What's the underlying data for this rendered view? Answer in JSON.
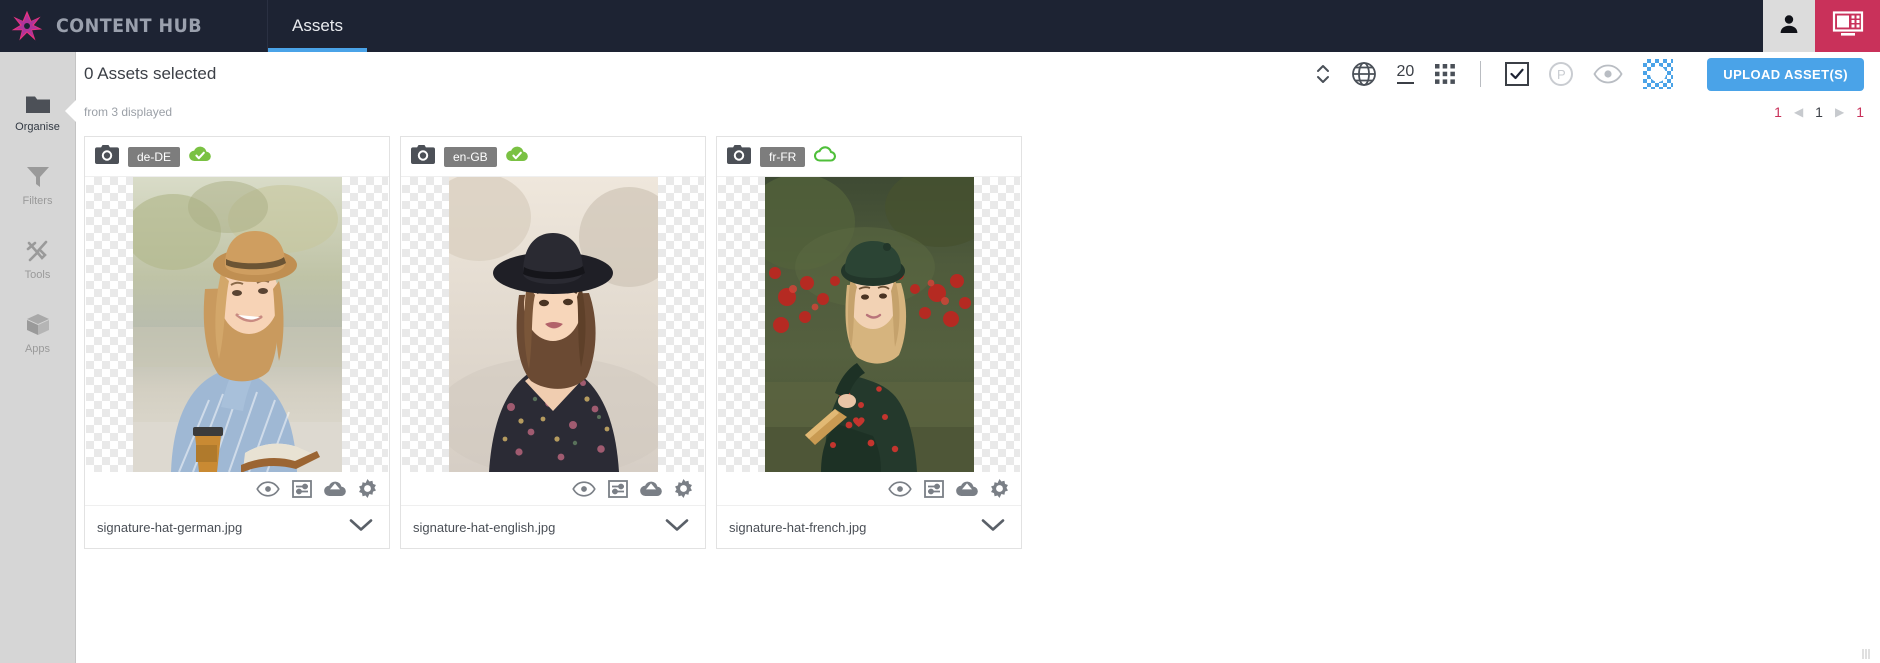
{
  "header": {
    "brand_name": "CONTENT HUB",
    "logo_icon": "starburst-logo-icon",
    "tabs": [
      {
        "label": "Assets",
        "active": true
      }
    ],
    "user_icon": "user-avatar-icon",
    "dashboard_icon": "dashboard-grid-icon",
    "user_bg": "#dcdcdc",
    "dashboard_bg": "#c9315a",
    "bar_bg": "#1d2333",
    "tab_underline": "#4aa3e8"
  },
  "sidebar": {
    "items": [
      {
        "label": "Organise",
        "icon": "folder-icon",
        "active": true
      },
      {
        "label": "Filters",
        "icon": "funnel-icon",
        "active": false
      },
      {
        "label": "Tools",
        "icon": "wrench-hammer-icon",
        "active": false
      },
      {
        "label": "Apps",
        "icon": "cube-box-icon",
        "active": false
      }
    ]
  },
  "toolbar": {
    "selected_text": "0 Assets selected",
    "sort_icon": "sort-updown-icon",
    "globe_icon": "globe-icon",
    "page_size": "20",
    "grid_view_icon": "grid-view-icon",
    "select_all_icon": "checkbox-checked-icon",
    "publish_icon": "p-circle-icon",
    "preview_icon": "eye-icon",
    "transparency_icon": "transparency-checker-icon",
    "upload_label": "UPLOAD ASSET(S)",
    "upload_color": "#4aa3e8"
  },
  "subbar": {
    "displayed_text": "from 3 displayed",
    "pagination": {
      "first": "1",
      "prev_icon": "chevron-left-icon",
      "current": "1",
      "next_icon": "chevron-right-icon",
      "last": "1",
      "accent_color": "#c9315a"
    }
  },
  "cards": [
    {
      "camera_icon": "camera-icon",
      "language": "de-DE",
      "status_icon": "cloud-check-icon",
      "status": "published",
      "status_color": "#7ac143",
      "file_name": "signature-hat-german.jpg",
      "tools": [
        "eye-icon",
        "metadata-panel-icon",
        "cloud-upload-icon",
        "gear-icon"
      ],
      "chevron_icon": "chevron-down-icon",
      "image_alt": "Smiling woman in straw hat and striped blue shirt with coffee cup and open book"
    },
    {
      "camera_icon": "camera-icon",
      "language": "en-GB",
      "status_icon": "cloud-check-icon",
      "status": "published",
      "status_color": "#7ac143",
      "file_name": "signature-hat-english.jpg",
      "tools": [
        "eye-icon",
        "metadata-panel-icon",
        "cloud-upload-icon",
        "gear-icon"
      ],
      "chevron_icon": "chevron-down-icon",
      "image_alt": "Woman in black wide-brim hat and floral dress outdoors"
    },
    {
      "camera_icon": "camera-icon",
      "language": "fr-FR",
      "status_icon": "cloud-outline-icon",
      "status": "unpublished",
      "status_color": "#7ac143",
      "file_name": "signature-hat-french.jpg",
      "tools": [
        "eye-icon",
        "metadata-panel-icon",
        "cloud-upload-icon",
        "gear-icon"
      ],
      "chevron_icon": "chevron-down-icon",
      "image_alt": "Woman in dark green dress and beret sitting by red flowers holding a baguette"
    }
  ]
}
